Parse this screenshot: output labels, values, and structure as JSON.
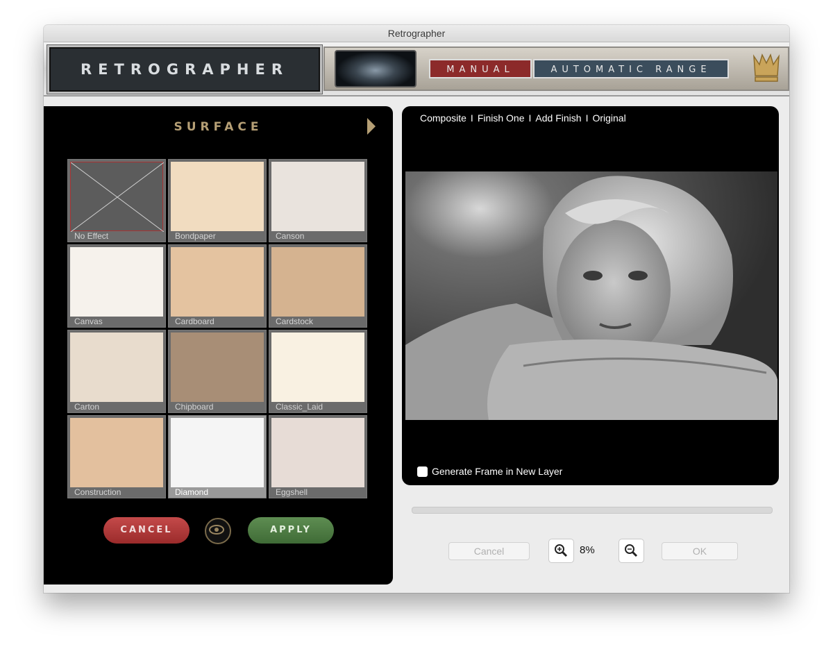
{
  "window": {
    "title": "Retrographer"
  },
  "header": {
    "logo_text": "RETROGRAPHER",
    "tabs": [
      "MANUAL",
      "AUTOMATIC RANGE"
    ],
    "active_tab": "MANUAL"
  },
  "surface": {
    "title": "SURFACE",
    "tiles": [
      {
        "label": "No Effect",
        "color": "#5c5c5c"
      },
      {
        "label": "Bondpaper",
        "color": "#f1dcc0"
      },
      {
        "label": "Canson",
        "color": "#e9e3dd"
      },
      {
        "label": "Canvas",
        "color": "#f6f2ec"
      },
      {
        "label": "Cardboard",
        "color": "#e4c3a0"
      },
      {
        "label": "Cardstock",
        "color": "#d5b390"
      },
      {
        "label": "Carton",
        "color": "#e8dccd"
      },
      {
        "label": "Chipboard",
        "color": "#a88e76"
      },
      {
        "label": "Classic_Laid",
        "color": "#f9f1e2"
      },
      {
        "label": "Construction",
        "color": "#e3c09e"
      },
      {
        "label": "Diamond",
        "color": "#f5f5f5"
      },
      {
        "label": "Eggshell",
        "color": "#e7dcd6"
      }
    ],
    "selected_label": "Diamond",
    "cancel_label": "CANCEL",
    "apply_label": "APPLY"
  },
  "preview": {
    "links": [
      "Composite",
      "Finish One",
      "Add Finish",
      "Original"
    ],
    "separator": "I",
    "generate_frame_label": "Generate Frame in New Layer",
    "generate_frame_checked": false
  },
  "footer": {
    "cancel_label": "Cancel",
    "ok_label": "OK",
    "zoom": "8%",
    "progress": 0
  }
}
